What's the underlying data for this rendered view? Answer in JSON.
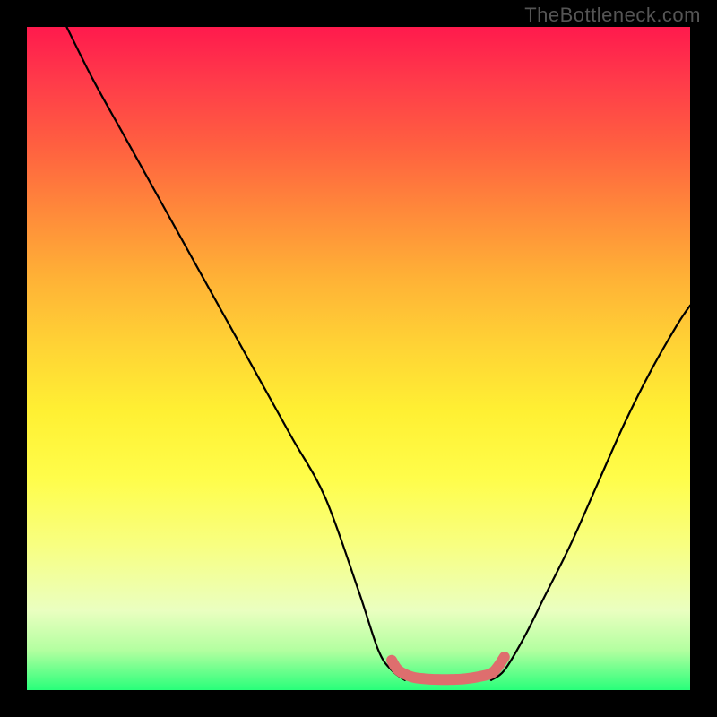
{
  "watermark": "TheBottleneck.com",
  "chart_data": {
    "type": "line",
    "title": "",
    "xlabel": "",
    "ylabel": "",
    "xlim": [
      0,
      100
    ],
    "ylim": [
      0,
      100
    ],
    "series": [
      {
        "name": "left-curve",
        "x": [
          6,
          10,
          15,
          20,
          25,
          30,
          35,
          40,
          45,
          50,
          53,
          55,
          57
        ],
        "values": [
          100,
          92,
          83,
          74,
          65,
          56,
          47,
          38,
          29,
          15,
          6,
          3,
          1.5
        ]
      },
      {
        "name": "right-curve",
        "x": [
          70,
          72,
          75,
          78,
          82,
          86,
          90,
          94,
          98,
          100
        ],
        "values": [
          1.5,
          3,
          8,
          14,
          22,
          31,
          40,
          48,
          55,
          58
        ]
      }
    ],
    "pink_band": {
      "name": "flat-zone",
      "x": [
        55,
        56,
        58,
        60,
        62,
        64,
        66,
        68,
        70,
        71,
        72
      ],
      "values": [
        4.5,
        3,
        2,
        1.7,
        1.6,
        1.6,
        1.7,
        2,
        2.5,
        3.5,
        5
      ]
    },
    "gradient_stops": [
      {
        "pos": 0,
        "color": "#ff1a4d"
      },
      {
        "pos": 8,
        "color": "#ff3a4a"
      },
      {
        "pos": 18,
        "color": "#ff6040"
      },
      {
        "pos": 28,
        "color": "#ff8a3a"
      },
      {
        "pos": 38,
        "color": "#ffb236"
      },
      {
        "pos": 48,
        "color": "#ffd335"
      },
      {
        "pos": 58,
        "color": "#fff033"
      },
      {
        "pos": 68,
        "color": "#fffd4a"
      },
      {
        "pos": 78,
        "color": "#f8ff80"
      },
      {
        "pos": 88,
        "color": "#eaffc0"
      },
      {
        "pos": 94,
        "color": "#b3ffa0"
      },
      {
        "pos": 100,
        "color": "#28ff7a"
      }
    ],
    "colors": {
      "curve": "#000000",
      "pink_band": "#de6e6e",
      "background": "#000000"
    }
  }
}
